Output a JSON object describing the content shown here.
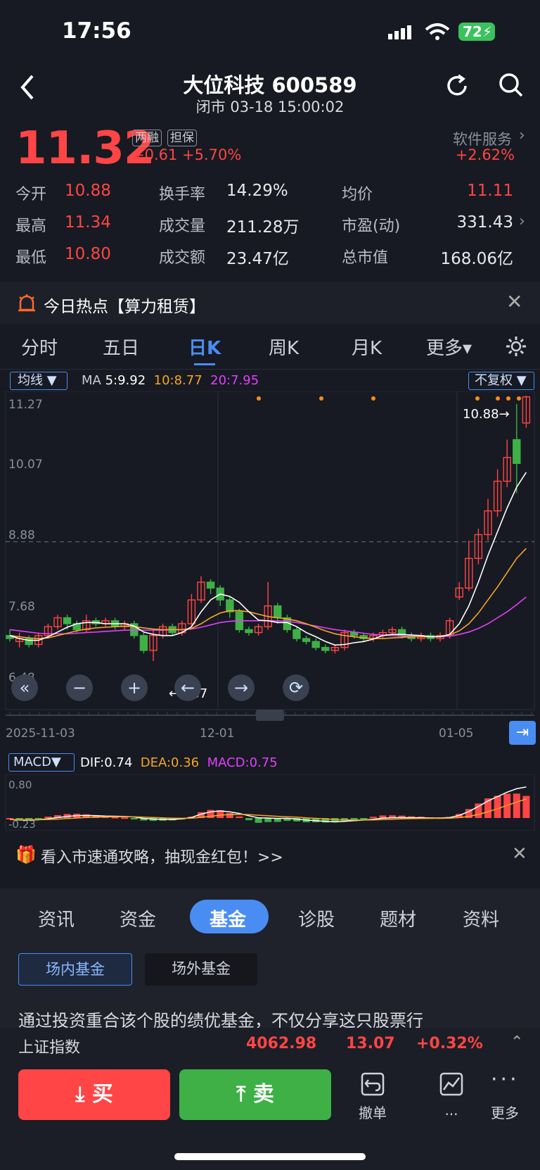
{
  "status": {
    "time": "17:56",
    "battery": "72"
  },
  "header": {
    "title": "大位科技 600589",
    "subtitle": "闭市 03-18 15:00:02"
  },
  "quote": {
    "price": "11.32",
    "tags": [
      "两融",
      "担保"
    ],
    "change": "+0.61",
    "change_pct": "+5.70%",
    "sector": "软件服务",
    "sector_change": "+2.62%",
    "rows": [
      [
        {
          "label": "今开",
          "value": "10.88"
        },
        {
          "label": "换手率",
          "value": "14.29%"
        },
        {
          "label": "均价",
          "value": "11.11"
        }
      ],
      [
        {
          "label": "最高",
          "value": "11.34"
        },
        {
          "label": "成交量",
          "value": "211.28万"
        },
        {
          "label": "市盈(动)",
          "value": "331.43"
        }
      ],
      [
        {
          "label": "最低",
          "value": "10.80"
        },
        {
          "label": "成交额",
          "value": "23.47亿"
        },
        {
          "label": "总市值",
          "value": "168.06亿"
        }
      ]
    ]
  },
  "hot": {
    "text": "今日热点【算力租赁】"
  },
  "ktabs": [
    "分时",
    "五日",
    "日K",
    "周K",
    "月K",
    "更多"
  ],
  "chart_toolbar": {
    "ma_button": "均线",
    "ma_label": "MA",
    "ma5": "5:9.92",
    "ma10": "10:8.77",
    "ma20": "20:7.95",
    "adjust_button": "不复权"
  },
  "colors": {
    "up": "#ff4545",
    "down": "#3eb046",
    "ma5": "#ffffff",
    "ma10": "#f5a623",
    "ma20": "#e040fb",
    "accent": "#4a8df2"
  },
  "chart_data": {
    "type": "candlestick",
    "y_ticks": [
      "11.27",
      "10.07",
      "8.88",
      "7.68",
      "6.48"
    ],
    "ylim": [
      6.48,
      11.27
    ],
    "x_ticks": [
      "2025-11-03",
      "12-01",
      "01-05"
    ],
    "annotations": {
      "high": "10.88→",
      "low": "←6.87"
    },
    "candles": [
      [
        7.3,
        7.25,
        7.4,
        7.2
      ],
      [
        7.2,
        7.25,
        7.35,
        7.1
      ],
      [
        7.25,
        7.15,
        7.3,
        7.1
      ],
      [
        7.15,
        7.3,
        7.35,
        7.1
      ],
      [
        7.3,
        7.45,
        7.5,
        7.25
      ],
      [
        7.45,
        7.6,
        7.65,
        7.4
      ],
      [
        7.6,
        7.5,
        7.65,
        7.4
      ],
      [
        7.5,
        7.4,
        7.55,
        7.35
      ],
      [
        7.4,
        7.55,
        7.65,
        7.35
      ],
      [
        7.55,
        7.5,
        7.6,
        7.45
      ],
      [
        7.5,
        7.55,
        7.6,
        7.45
      ],
      [
        7.55,
        7.45,
        7.6,
        7.4
      ],
      [
        7.45,
        7.5,
        7.55,
        7.4
      ],
      [
        7.5,
        7.3,
        7.55,
        7.25
      ],
      [
        7.3,
        7.05,
        7.35,
        7.0
      ],
      [
        7.05,
        7.3,
        7.4,
        6.87
      ],
      [
        7.3,
        7.45,
        7.5,
        7.25
      ],
      [
        7.45,
        7.35,
        7.5,
        7.3
      ],
      [
        7.35,
        7.5,
        7.55,
        7.3
      ],
      [
        7.5,
        7.9,
        8.0,
        7.45
      ],
      [
        7.9,
        8.2,
        8.3,
        7.85
      ],
      [
        8.2,
        8.1,
        8.25,
        8.0
      ],
      [
        8.1,
        7.9,
        8.15,
        7.8
      ],
      [
        7.9,
        7.7,
        7.95,
        7.6
      ],
      [
        7.7,
        7.4,
        7.75,
        7.35
      ],
      [
        7.4,
        7.35,
        7.45,
        7.3
      ],
      [
        7.35,
        7.45,
        7.5,
        7.3
      ],
      [
        7.45,
        7.8,
        8.2,
        7.4
      ],
      [
        7.8,
        7.6,
        7.85,
        7.5
      ],
      [
        7.6,
        7.4,
        7.65,
        7.35
      ],
      [
        7.4,
        7.25,
        7.45,
        7.2
      ],
      [
        7.25,
        7.2,
        7.3,
        7.15
      ],
      [
        7.2,
        7.1,
        7.25,
        7.05
      ],
      [
        7.1,
        7.05,
        7.15,
        7.0
      ],
      [
        7.05,
        7.1,
        7.15,
        7.0
      ],
      [
        7.1,
        7.35,
        7.4,
        7.05
      ],
      [
        7.35,
        7.3,
        7.4,
        7.25
      ],
      [
        7.3,
        7.25,
        7.35,
        7.2
      ],
      [
        7.25,
        7.3,
        7.35,
        7.2
      ],
      [
        7.3,
        7.35,
        7.4,
        7.25
      ],
      [
        7.35,
        7.4,
        7.45,
        7.3
      ],
      [
        7.4,
        7.3,
        7.45,
        7.25
      ],
      [
        7.3,
        7.25,
        7.35,
        7.2
      ],
      [
        7.25,
        7.3,
        7.35,
        7.2
      ],
      [
        7.3,
        7.25,
        7.35,
        7.2
      ],
      [
        7.25,
        7.3,
        7.35,
        7.2
      ],
      [
        7.3,
        7.55,
        7.6,
        7.25
      ],
      [
        7.95,
        8.1,
        8.2,
        7.9
      ],
      [
        8.1,
        8.6,
        8.9,
        8.05
      ],
      [
        8.6,
        9.0,
        9.1,
        8.5
      ],
      [
        9.0,
        9.4,
        9.6,
        8.9
      ],
      [
        9.4,
        9.9,
        10.1,
        9.3
      ],
      [
        9.9,
        10.3,
        10.6,
        9.8
      ],
      [
        10.6,
        10.2,
        11.2,
        9.7
      ],
      [
        10.88,
        11.32,
        11.34,
        10.8
      ]
    ],
    "ma5": [
      7.3,
      7.25,
      7.22,
      7.22,
      7.28,
      7.36,
      7.44,
      7.5,
      7.52,
      7.52,
      7.5,
      7.5,
      7.5,
      7.46,
      7.36,
      7.32,
      7.3,
      7.3,
      7.35,
      7.45,
      7.7,
      7.9,
      8.0,
      7.96,
      7.86,
      7.7,
      7.56,
      7.55,
      7.52,
      7.52,
      7.45,
      7.35,
      7.28,
      7.2,
      7.14,
      7.15,
      7.18,
      7.2,
      7.24,
      7.3,
      7.32,
      7.32,
      7.31,
      7.3,
      7.28,
      7.28,
      7.32,
      7.5,
      7.8,
      8.2,
      8.65,
      9.05,
      9.45,
      9.8,
      10.05
    ],
    "ma10": [
      7.3,
      7.28,
      7.26,
      7.25,
      7.26,
      7.3,
      7.34,
      7.38,
      7.41,
      7.43,
      7.44,
      7.45,
      7.46,
      7.45,
      7.43,
      7.41,
      7.4,
      7.4,
      7.4,
      7.42,
      7.5,
      7.6,
      7.68,
      7.72,
      7.72,
      7.7,
      7.66,
      7.62,
      7.6,
      7.58,
      7.55,
      7.5,
      7.44,
      7.38,
      7.33,
      7.3,
      7.28,
      7.26,
      7.25,
      7.25,
      7.26,
      7.27,
      7.28,
      7.28,
      7.28,
      7.29,
      7.31,
      7.38,
      7.5,
      7.68,
      7.9,
      8.12,
      8.36,
      8.6,
      8.77
    ],
    "ma20": [
      7.4,
      7.38,
      7.36,
      7.34,
      7.33,
      7.33,
      7.33,
      7.34,
      7.35,
      7.36,
      7.37,
      7.38,
      7.39,
      7.39,
      7.39,
      7.39,
      7.39,
      7.4,
      7.4,
      7.41,
      7.44,
      7.48,
      7.52,
      7.54,
      7.55,
      7.55,
      7.55,
      7.55,
      7.55,
      7.54,
      7.52,
      7.49,
      7.46,
      7.43,
      7.4,
      7.38,
      7.36,
      7.34,
      7.32,
      7.31,
      7.3,
      7.29,
      7.29,
      7.28,
      7.28,
      7.28,
      7.29,
      7.32,
      7.36,
      7.42,
      7.5,
      7.6,
      7.7,
      7.82,
      7.95
    ],
    "macd_panel": {
      "label": "MACD",
      "dif": "DIF:0.74",
      "dea": "DEA:0.36",
      "macd": "MACD:0.75",
      "y_ticks": [
        "0.80",
        "-0.23"
      ]
    }
  },
  "promo": {
    "text": "看入市速通攻略，抽现金红包！>>"
  },
  "bottom_tabs": [
    "资讯",
    "资金",
    "基金",
    "诊股",
    "题材",
    "资料"
  ],
  "fund_tabs": [
    "场内基金",
    "场外基金"
  ],
  "fund_desc": "通过投资重合该个股的绩优基金，不仅分享这只股票行",
  "index_bar": {
    "name": "上证指数",
    "value": "4062.98",
    "change": "13.07",
    "pct": "+0.32%"
  },
  "actions": {
    "buy": "买",
    "sell": "卖",
    "cancel": "撤单",
    "more1": "...",
    "more": "更多"
  }
}
